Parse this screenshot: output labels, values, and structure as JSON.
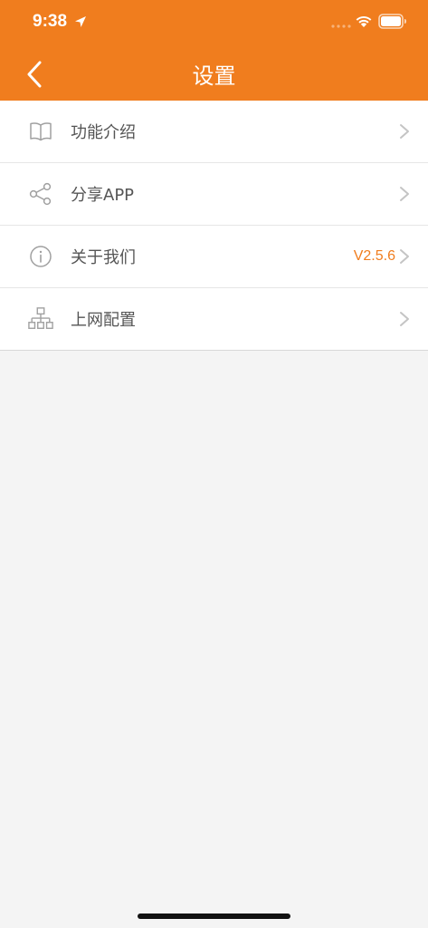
{
  "status_bar": {
    "time": "9:38",
    "icons": [
      "location-arrow-icon",
      "signal-dots-icon",
      "wifi-icon",
      "battery-icon"
    ]
  },
  "nav": {
    "title": "设置",
    "back_icon": "chevron-left-icon"
  },
  "colors": {
    "accent": "#f07d1e",
    "background": "#f4f4f4",
    "label_text": "#555555",
    "icon_gray": "#a0a0a0"
  },
  "settings": {
    "items": [
      {
        "label": "功能介绍",
        "icon": "book-icon",
        "value": ""
      },
      {
        "label": "分享APP",
        "icon": "share-icon",
        "value": ""
      },
      {
        "label": "关于我们",
        "icon": "info-icon",
        "value": "V2.5.6"
      },
      {
        "label": "上网配置",
        "icon": "network-icon",
        "value": ""
      }
    ]
  }
}
